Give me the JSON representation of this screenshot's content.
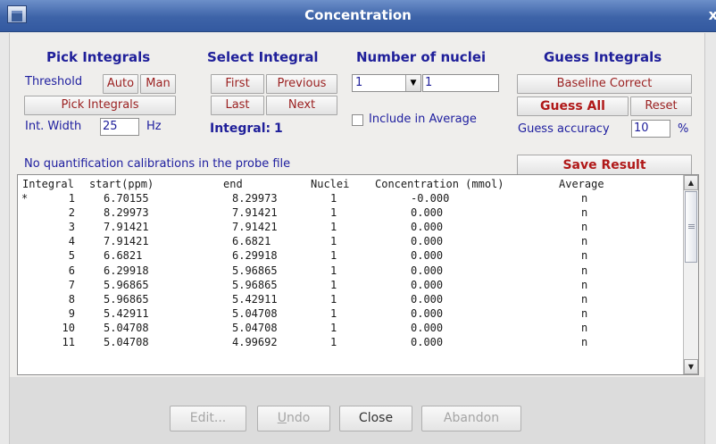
{
  "window": {
    "title": "Concentration",
    "close_glyph": "x"
  },
  "pick_integrals": {
    "header": "Pick Integrals",
    "threshold_label": "Threshold",
    "auto_button": "Auto",
    "man_button": "Man",
    "pick_button": "Pick Integrals",
    "width_label": "Int. Width",
    "width_value": "25",
    "width_unit": "Hz"
  },
  "select_integral": {
    "header": "Select Integral",
    "first_button": "First",
    "previous_button": "Previous",
    "last_button": "Last",
    "next_button": "Next",
    "current_label": "Integral:",
    "current_value": "1"
  },
  "nuclei": {
    "header": "Number of nuclei",
    "selected": "1",
    "value": "1",
    "include_label": "Include in Average",
    "include_checked": false
  },
  "guess_integrals": {
    "header": "Guess Integrals",
    "baseline_button": "Baseline Correct",
    "guess_all_button": "Guess All",
    "reset_button": "Reset",
    "accuracy_label": "Guess accuracy",
    "accuracy_value": "10",
    "accuracy_unit": "%"
  },
  "status_message": "No quantification calibrations in the probe file",
  "save_button": "Save Result",
  "table": {
    "columns": [
      "Integral",
      "start(ppm)",
      "end",
      "Nuclei",
      "Concentration (mmol)",
      "Average"
    ],
    "rows": [
      {
        "marker": "*",
        "integral": "1",
        "start": "6.70155",
        "end": "8.29973",
        "nuclei": "1",
        "conc": "-0.000",
        "avg": "n"
      },
      {
        "marker": "",
        "integral": "2",
        "start": "8.29973",
        "end": "7.91421",
        "nuclei": "1",
        "conc": "0.000",
        "avg": "n"
      },
      {
        "marker": "",
        "integral": "3",
        "start": "7.91421",
        "end": "7.91421",
        "nuclei": "1",
        "conc": "0.000",
        "avg": "n"
      },
      {
        "marker": "",
        "integral": "4",
        "start": "7.91421",
        "end": "6.6821",
        "nuclei": "1",
        "conc": "0.000",
        "avg": "n"
      },
      {
        "marker": "",
        "integral": "5",
        "start": "6.6821",
        "end": "6.29918",
        "nuclei": "1",
        "conc": "0.000",
        "avg": "n"
      },
      {
        "marker": "",
        "integral": "6",
        "start": "6.29918",
        "end": "5.96865",
        "nuclei": "1",
        "conc": "0.000",
        "avg": "n"
      },
      {
        "marker": "",
        "integral": "7",
        "start": "5.96865",
        "end": "5.96865",
        "nuclei": "1",
        "conc": "0.000",
        "avg": "n"
      },
      {
        "marker": "",
        "integral": "8",
        "start": "5.96865",
        "end": "5.42911",
        "nuclei": "1",
        "conc": "0.000",
        "avg": "n"
      },
      {
        "marker": "",
        "integral": "9",
        "start": "5.42911",
        "end": "5.04708",
        "nuclei": "1",
        "conc": "0.000",
        "avg": "n"
      },
      {
        "marker": "",
        "integral": "10",
        "start": "5.04708",
        "end": "5.04708",
        "nuclei": "1",
        "conc": "0.000",
        "avg": "n"
      },
      {
        "marker": "",
        "integral": "11",
        "start": "5.04708",
        "end": "4.99692",
        "nuclei": "1",
        "conc": "0.000",
        "avg": "n"
      }
    ]
  },
  "footer": {
    "edit_button": "Edit...",
    "undo_button": "Undo",
    "close_button": "Close",
    "abandon_button": "Abandon"
  },
  "colors": {
    "title_bar": "#3d63a8",
    "label_blue": "#2020a0",
    "button_red": "#b01818"
  },
  "icons": [
    "app-icon",
    "close-icon",
    "combo-arrow-icon",
    "scroll-up-icon",
    "scroll-down-icon",
    "scroll-grip-icon"
  ]
}
